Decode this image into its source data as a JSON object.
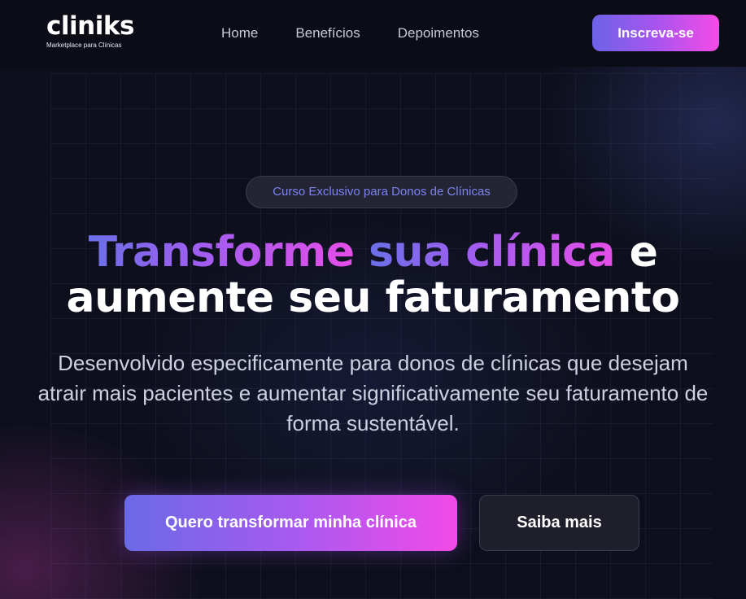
{
  "brand": {
    "name": "cliniks",
    "tagline": "Marketplace para Clínicas"
  },
  "nav": {
    "items": [
      {
        "label": "Home"
      },
      {
        "label": "Benefícios"
      },
      {
        "label": "Depoimentos"
      }
    ],
    "cta_label": "Inscreva-se"
  },
  "hero": {
    "badge": "Curso Exclusivo para Donos de Clínicas",
    "headline": {
      "highlight_1": "Transforme",
      "highlight_2": "sua clínica",
      "rest_line_1": "e",
      "line_2": "aumente seu faturamento"
    },
    "subtitle": "Desenvolvido especificamente para donos de clínicas que desejam atrair mais pacientes e aumentar significativamente seu faturamento de forma sustentável.",
    "primary_cta": "Quero transformar minha clínica",
    "secondary_cta": "Saiba mais"
  },
  "colors": {
    "background": "#0d0f1c",
    "gradient_start": "#6c63e6",
    "gradient_mid": "#a855f0",
    "gradient_end": "#f54be6",
    "badge_text": "#7c83ee"
  }
}
